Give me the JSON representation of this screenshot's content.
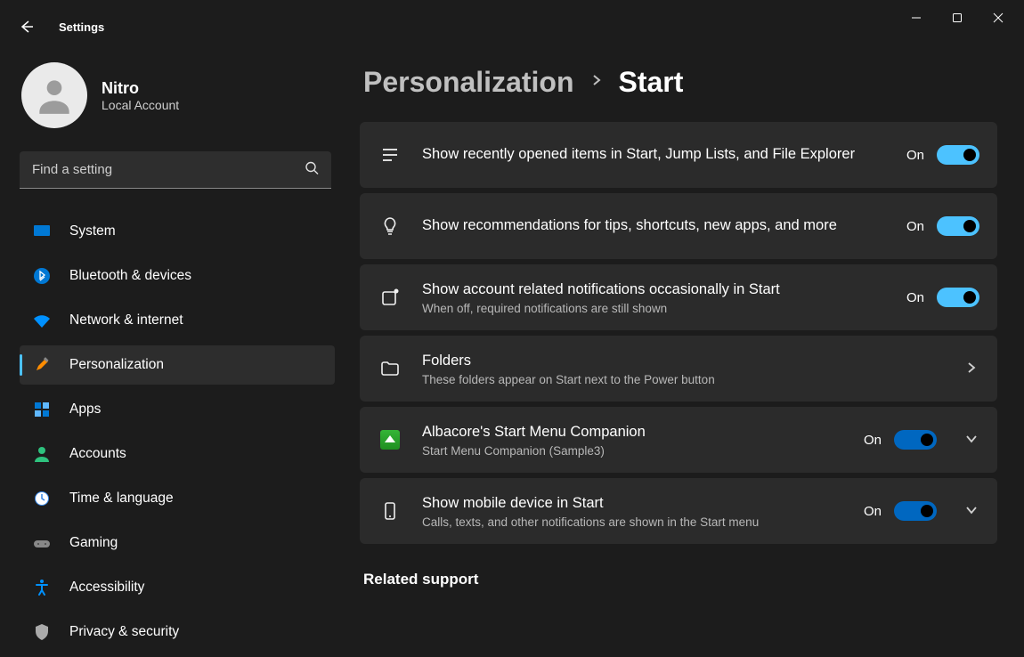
{
  "window": {
    "app_title": "Settings"
  },
  "user": {
    "name": "Nitro",
    "type": "Local Account"
  },
  "search": {
    "placeholder": "Find a setting"
  },
  "nav": {
    "system": "System",
    "bluetooth": "Bluetooth & devices",
    "network": "Network & internet",
    "personalization": "Personalization",
    "apps": "Apps",
    "accounts": "Accounts",
    "time": "Time & language",
    "gaming": "Gaming",
    "accessibility": "Accessibility",
    "privacy": "Privacy & security"
  },
  "breadcrumb": {
    "parent": "Personalization",
    "current": "Start"
  },
  "settings": [
    {
      "key": "recent",
      "title": "Show recently opened items in Start, Jump Lists, and File Explorer",
      "sub": "",
      "toggle": "On",
      "icon": "list"
    },
    {
      "key": "tips",
      "title": "Show recommendations for tips, shortcuts, new apps, and more",
      "sub": "",
      "toggle": "On",
      "icon": "bulb"
    },
    {
      "key": "account_notif",
      "title": "Show account related notifications occasionally in Start",
      "sub": "When off, required notifications are still shown",
      "toggle": "On",
      "icon": "square_dot"
    },
    {
      "key": "folders",
      "title": "Folders",
      "sub": "These folders appear on Start next to the Power button",
      "nav": true,
      "icon": "folder"
    },
    {
      "key": "companion",
      "title": "Albacore's Start Menu Companion",
      "sub": "Start Menu Companion (Sample3)",
      "toggle": "On",
      "expand": true,
      "icon": "companion",
      "toggleAlt": true
    },
    {
      "key": "mobile",
      "title": "Show mobile device in Start",
      "sub": "Calls, texts, and other notifications are shown in the Start menu",
      "toggle": "On",
      "expand": true,
      "icon": "phone",
      "toggleAlt": true
    }
  ],
  "related": "Related support"
}
